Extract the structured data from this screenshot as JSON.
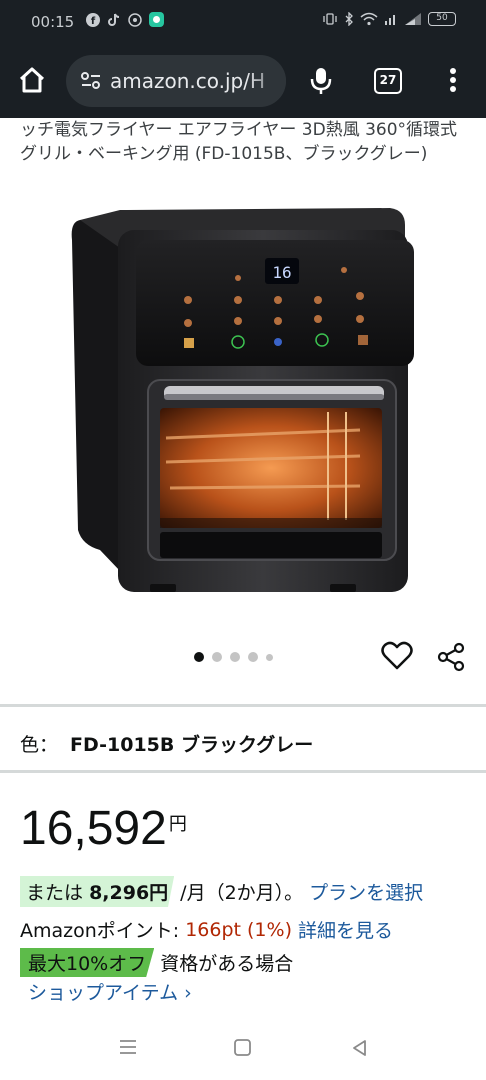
{
  "status_bar": {
    "time": "00:15",
    "battery": "50"
  },
  "browser": {
    "url": "amazon.co.jp/H",
    "tab_count": "27"
  },
  "product": {
    "title": "ッチ電気フライヤー エアフライヤー 3D熱風 360°循環式 グリル・ベーキング用 (FD-1015B、ブラックグレー)",
    "display_reading": "16",
    "color_label": "色：",
    "color_value": "FD-1015B ブラックグレー",
    "price_value": "16,592",
    "price_currency": "円",
    "installment_prefix": "または",
    "installment_amount": "8,296円",
    "installment_suffix": "/月（2か月）。",
    "installment_link": "プランを選択",
    "points_label": "Amazonポイント:",
    "points_value": "166pt (1%)",
    "points_link": "詳細を見る",
    "discount_badge": "最大10%オフ",
    "discount_text": "資格がある場合",
    "shop_link": "ショップアイテム ›"
  },
  "carousel": {
    "count": 5,
    "active_index": 0
  },
  "colors": {
    "link": "#1d5a9c",
    "price_accent": "#b12704",
    "badge_light_green": "#d4f4d6",
    "badge_green": "#5dbb4a",
    "browser_dark": "#1a1f24"
  }
}
